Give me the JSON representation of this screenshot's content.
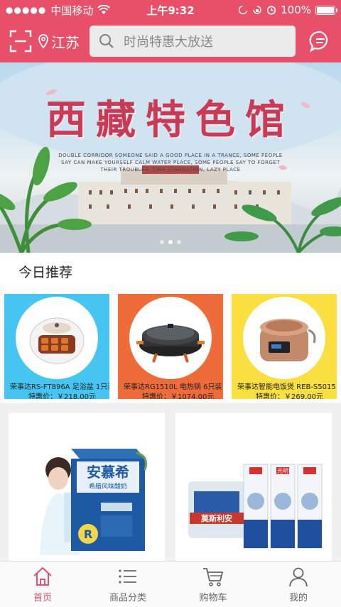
{
  "status_bar": {
    "carrier": "中国移动",
    "time": "上午9:32",
    "battery": "100%"
  },
  "header": {
    "location": "江苏",
    "search_placeholder": "时尚特惠大放送"
  },
  "banner": {
    "title": "西藏特色馆",
    "subtitle": "DOUBLE CORRIDOR SOMEONE SAID A GOOD PLACE IN A TRANCE, SOME PEOPLE SAY CAN MAKE YOURSELF CALM WATER PLACE, SOME PEOPLE SAY TO FORGET THEIR TROUBLES, TIME STAGNATION, LAZY PLACE"
  },
  "section": {
    "title": "今日推荐"
  },
  "recommendations": [
    {
      "name": "荣事达RS-FT896A 足浴盆 1只装",
      "price_label": "特惠价：",
      "price": "￥218.00元",
      "bg": "#46c4f2"
    },
    {
      "name": "荣事达RG1510L 电热锅 6只装",
      "price_label": "特惠价：",
      "price": "￥1074.00元",
      "bg": "#ee6b3a"
    },
    {
      "name": "荣事达智能电饭煲 REB-S5015 1台",
      "price_label": "特惠价：",
      "price": "￥269.00元",
      "bg": "#f9e040"
    }
  ],
  "products": [
    {
      "brand": "安慕希",
      "tagline": "希腊风味酸奶",
      "badge": "R"
    },
    {
      "brand": "莫斯利安",
      "badge": "光明"
    }
  ],
  "tabs": [
    {
      "label": "首页",
      "icon": "home-icon",
      "active": true
    },
    {
      "label": "商品分类",
      "icon": "list-icon",
      "active": false
    },
    {
      "label": "购物车",
      "icon": "cart-icon",
      "active": false
    },
    {
      "label": "我的",
      "icon": "user-icon",
      "active": false
    }
  ],
  "colors": {
    "accent": "#e8506a"
  }
}
